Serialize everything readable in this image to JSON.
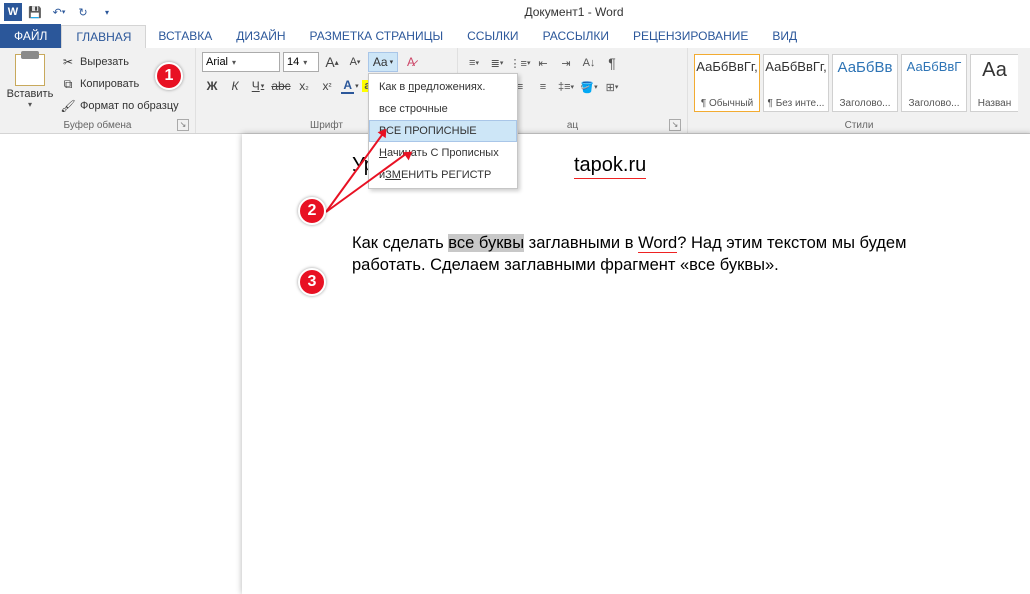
{
  "title": "Документ1 - Word",
  "tabs": {
    "file": "ФАЙЛ",
    "items": [
      "ГЛАВНАЯ",
      "ВСТАВКА",
      "ДИЗАЙН",
      "РАЗМЕТКА СТРАНИЦЫ",
      "ССЫЛКИ",
      "РАССЫЛКИ",
      "РЕЦЕНЗИРОВАНИЕ",
      "ВИД"
    ]
  },
  "clipboard": {
    "paste": "Вставить",
    "cut": "Вырезать",
    "copy": "Копировать",
    "format": "Формат по образцу",
    "group": "Буфер обмена"
  },
  "font": {
    "name": "Arial",
    "size": "14",
    "group": "Шрифт",
    "case_label": "Aa"
  },
  "case_menu": {
    "sentence": "Как в предложениях.",
    "lower": "все строчные",
    "upper": "ВСЕ ПРОПИСНЫЕ",
    "capitalize": "Начинать С Прописных",
    "toggle": "иЗМЕНИТЬ РЕГИСТР"
  },
  "paragraph": {
    "group": "ац"
  },
  "styles": {
    "group": "Стили",
    "items": [
      {
        "sample": "АаБбВвГг,",
        "name": "¶ Обычный"
      },
      {
        "sample": "АаБбВвГг,",
        "name": "¶ Без инте..."
      },
      {
        "sample": "АаБбВв",
        "name": "Заголово..."
      },
      {
        "sample": "АаБбВвГ",
        "name": "Заголово..."
      },
      {
        "sample": "Аа",
        "name": "Назван"
      }
    ]
  },
  "doc": {
    "heading_left": "Уро",
    "heading_right": "tapok.ru",
    "body_pre": "Как сделать ",
    "body_sel": "все буквы",
    "body_mid": " заглавными в ",
    "body_word": "Word",
    "body_after": "? Над этим текстом мы будем работать. Сделаем заглавными фрагмент «все буквы»."
  },
  "callouts": {
    "c1": "1",
    "c2": "2",
    "c3": "3"
  }
}
